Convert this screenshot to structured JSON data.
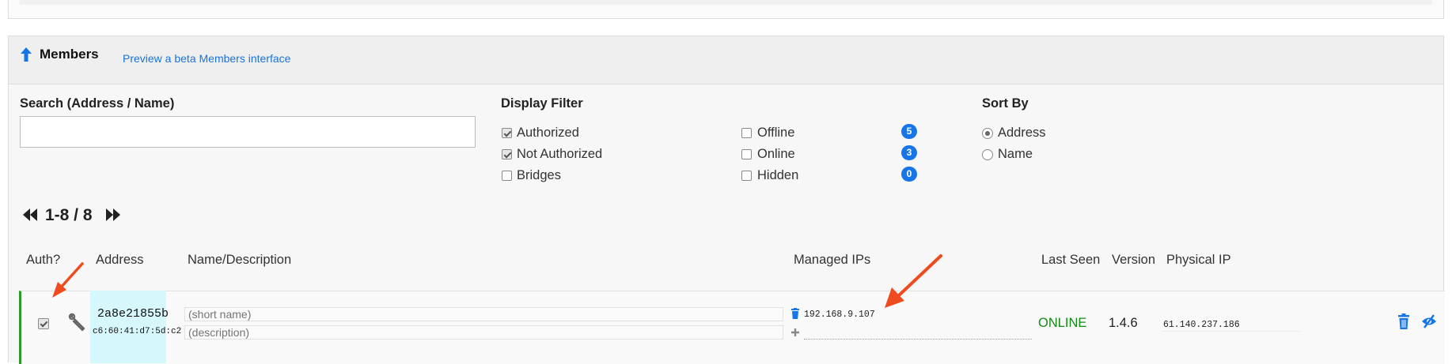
{
  "members": {
    "title": "Members",
    "beta_link": "Preview a beta Members interface",
    "search": {
      "label": "Search (Address / Name)",
      "value": "",
      "placeholder": ""
    },
    "display_filter": {
      "label": "Display Filter",
      "options": [
        {
          "label": "Authorized",
          "checked": true
        },
        {
          "label": "Not Authorized",
          "checked": true
        },
        {
          "label": "Bridges",
          "checked": false
        },
        {
          "label": "Offline",
          "checked": false,
          "count": "5"
        },
        {
          "label": "Online",
          "checked": false,
          "count": "3"
        },
        {
          "label": "Hidden",
          "checked": false,
          "count": "0"
        }
      ]
    },
    "sort_by": {
      "label": "Sort By",
      "options": [
        {
          "label": "Address",
          "selected": true
        },
        {
          "label": "Name",
          "selected": false
        }
      ]
    },
    "pagination": {
      "range": "1-8 / 8"
    },
    "columns": [
      "Auth?",
      "Address",
      "Name/Description",
      "Managed IPs",
      "Last Seen",
      "Version",
      "Physical IP"
    ],
    "rows": [
      {
        "authorized": true,
        "address": "2a8e21855b",
        "mac": "c6:60:41:d7:5d:c2",
        "name_placeholder": "(short name)",
        "description_placeholder": "(description)",
        "managed_ip": "192.168.9.107",
        "last_seen": "ONLINE",
        "version": "1.4.6",
        "physical_ip": "61.140.237.186"
      }
    ]
  },
  "colors": {
    "accent": "#1676e8",
    "online": "#138a13",
    "annotation": "#f04a1f",
    "row_border": "#2c9b2c"
  }
}
